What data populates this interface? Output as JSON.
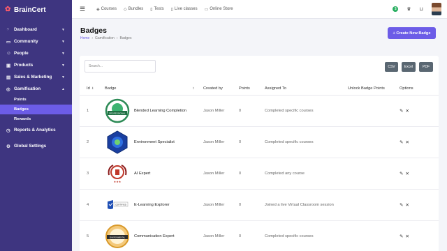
{
  "brand": {
    "name": "BrainCert"
  },
  "sidebar": {
    "items": [
      {
        "label": "Dashboard",
        "icon": "dashboard-icon",
        "has_chevron": true
      },
      {
        "label": "Community",
        "icon": "community-icon",
        "has_chevron": true
      },
      {
        "label": "People",
        "icon": "people-icon",
        "has_chevron": true
      },
      {
        "label": "Products",
        "icon": "products-icon",
        "has_chevron": true
      },
      {
        "label": "Sales & Marketing",
        "icon": "sales-icon",
        "has_chevron": true
      },
      {
        "label": "Gamification",
        "icon": "gamification-icon",
        "has_chevron": true
      }
    ],
    "sub_items": [
      {
        "label": "Points",
        "active": false
      },
      {
        "label": "Badges",
        "active": true
      },
      {
        "label": "Rewards",
        "active": false
      }
    ],
    "bottom_items": [
      {
        "label": "Reports & Analytics",
        "icon": "analytics-icon"
      },
      {
        "label": "Global Settings",
        "icon": "settings-icon"
      }
    ]
  },
  "topbar": {
    "links": [
      {
        "label": "Courses",
        "icon": "courses-icon"
      },
      {
        "label": "Bundles",
        "icon": "bundles-icon"
      },
      {
        "label": "Tests",
        "icon": "tests-icon"
      },
      {
        "label": "Live classes",
        "icon": "live-classes-icon"
      },
      {
        "label": "Online Store",
        "icon": "store-icon"
      }
    ],
    "status_badge": "$"
  },
  "header": {
    "title": "Badges",
    "breadcrumb": [
      "Home",
      "Gamification",
      "Badges"
    ],
    "create_button": "+ Create New Badge"
  },
  "table": {
    "search_placeholder": "Search...",
    "export_buttons": [
      "CSV",
      "Excel",
      "PDF"
    ],
    "columns": [
      "Id",
      "Badge",
      "Created by",
      "Points",
      "Assigned To",
      "Unlock Badge Points",
      "Options"
    ],
    "rows": [
      {
        "id": "1",
        "name": "Blended Learning Completion",
        "created_by": "Jason Miller",
        "points": "0",
        "assigned_to": "Completed specific courses",
        "badge_style": "green",
        "badge_text": "PROFESSIONAL"
      },
      {
        "id": "2",
        "name": "Environment Specialist",
        "created_by": "Jason Miller",
        "points": "0",
        "assigned_to": "Completed specific courses",
        "badge_style": "blue",
        "badge_text": ""
      },
      {
        "id": "3",
        "name": "AI Expert",
        "created_by": "Jason Miller",
        "points": "0",
        "assigned_to": "Completed any course",
        "badge_style": "red",
        "badge_text": ""
      },
      {
        "id": "4",
        "name": "E-Learning Explorer",
        "created_by": "Jason Miller",
        "points": "0",
        "assigned_to": "Joined a live Virtual Classroom session",
        "badge_style": "shield",
        "badge_text": "CERTIFIED"
      },
      {
        "id": "5",
        "name": "Communication Expert",
        "created_by": "Jason Miller",
        "points": "0",
        "assigned_to": "Completed specific courses",
        "badge_style": "gold",
        "badge_text": "ENVIRONMENTAL"
      }
    ]
  },
  "colors": {
    "sidebar_bg": "#3e3580",
    "accent": "#6c5ce7",
    "export_btn": "#5a6772"
  }
}
